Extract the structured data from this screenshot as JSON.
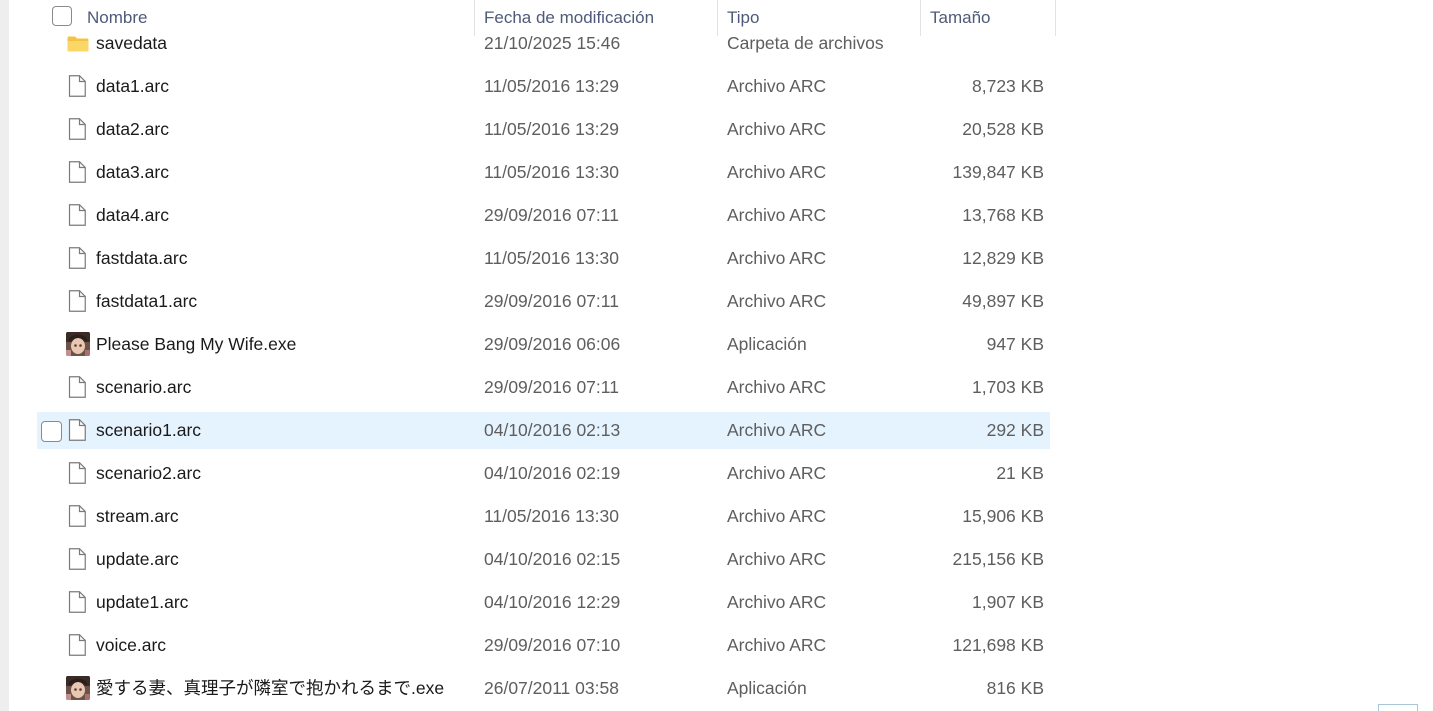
{
  "columns": {
    "name": "Nombre",
    "date": "Fecha de modificación",
    "type": "Tipo",
    "size": "Tamaño"
  },
  "rows": [
    {
      "name": "savedata",
      "date": "21/10/2025 15:46",
      "type": "Carpeta de archivos",
      "size": "",
      "icon": "folder-icon"
    },
    {
      "name": "data1.arc",
      "date": "11/05/2016 13:29",
      "type": "Archivo ARC",
      "size": "8,723 KB",
      "icon": "file-icon"
    },
    {
      "name": "data2.arc",
      "date": "11/05/2016 13:29",
      "type": "Archivo ARC",
      "size": "20,528 KB",
      "icon": "file-icon"
    },
    {
      "name": "data3.arc",
      "date": "11/05/2016 13:30",
      "type": "Archivo ARC",
      "size": "139,847 KB",
      "icon": "file-icon"
    },
    {
      "name": "data4.arc",
      "date": "29/09/2016 07:11",
      "type": "Archivo ARC",
      "size": "13,768 KB",
      "icon": "file-icon"
    },
    {
      "name": "fastdata.arc",
      "date": "11/05/2016 13:30",
      "type": "Archivo ARC",
      "size": "12,829 KB",
      "icon": "file-icon"
    },
    {
      "name": "fastdata1.arc",
      "date": "29/09/2016 07:11",
      "type": "Archivo ARC",
      "size": "49,897 KB",
      "icon": "file-icon"
    },
    {
      "name": "Please Bang My Wife.exe",
      "date": "29/09/2016 06:06",
      "type": "Aplicación",
      "size": "947 KB",
      "icon": "app-icon"
    },
    {
      "name": "scenario.arc",
      "date": "29/09/2016 07:11",
      "type": "Archivo ARC",
      "size": "1,703 KB",
      "icon": "file-icon"
    },
    {
      "name": "scenario1.arc",
      "date": "04/10/2016 02:13",
      "type": "Archivo ARC",
      "size": "292 KB",
      "icon": "file-icon",
      "hover": true
    },
    {
      "name": "scenario2.arc",
      "date": "04/10/2016 02:19",
      "type": "Archivo ARC",
      "size": "21 KB",
      "icon": "file-icon"
    },
    {
      "name": "stream.arc",
      "date": "11/05/2016 13:30",
      "type": "Archivo ARC",
      "size": "15,906 KB",
      "icon": "file-icon"
    },
    {
      "name": "update.arc",
      "date": "04/10/2016 02:15",
      "type": "Archivo ARC",
      "size": "215,156 KB",
      "icon": "file-icon"
    },
    {
      "name": "update1.arc",
      "date": "04/10/2016 12:29",
      "type": "Archivo ARC",
      "size": "1,907 KB",
      "icon": "file-icon"
    },
    {
      "name": "voice.arc",
      "date": "29/09/2016 07:10",
      "type": "Archivo ARC",
      "size": "121,698 KB",
      "icon": "file-icon"
    },
    {
      "name": "愛する妻、真理子が隣室で抱かれるまで.exe",
      "date": "26/07/2011 03:58",
      "type": "Aplicación",
      "size": "816 KB",
      "icon": "app-icon"
    }
  ],
  "colors": {
    "hover_row": "#e5f3ff",
    "header_text": "#4f5a78",
    "secondary_text": "#5e5e5e",
    "folder": "#f8c84a"
  }
}
